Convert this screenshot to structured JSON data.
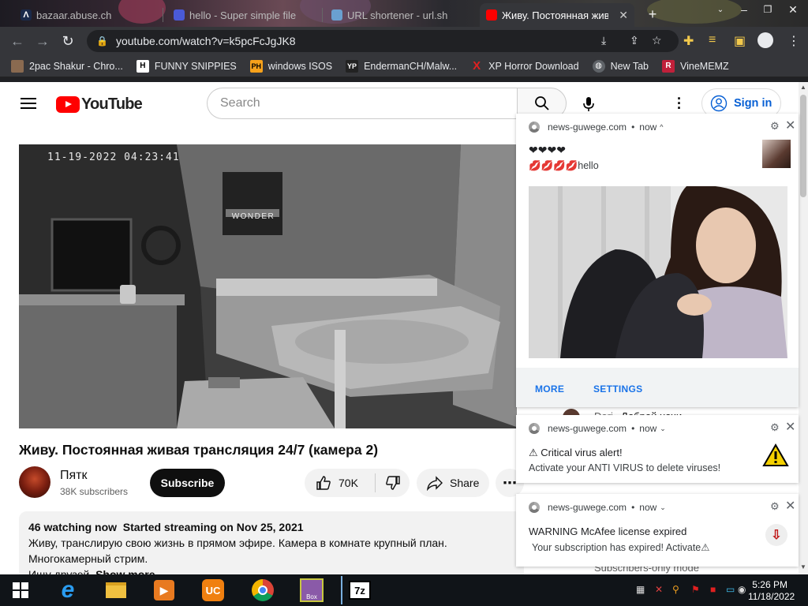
{
  "browser": {
    "tabs": [
      {
        "label": "bazaar.abuse.ch",
        "active": false
      },
      {
        "label": "hello - Super simple file",
        "active": false
      },
      {
        "label": "URL shortener - url.sh",
        "active": false
      },
      {
        "label": "Живу. Постоянная жива",
        "active": true
      }
    ],
    "url": "youtube.com/watch?v=k5pcFcJgJK8",
    "bookmarks": [
      {
        "label": "2pac Shakur - Chro...",
        "icon": "ph-icon"
      },
      {
        "label": "FUNNY SNIPPIES",
        "icon": "H"
      },
      {
        "label": "windows ISOS",
        "icon": "PH"
      },
      {
        "label": "EndermanCH/Malw...",
        "icon": "YP"
      },
      {
        "label": "XP Horror Download",
        "icon": "X"
      },
      {
        "label": "New Tab",
        "icon": "globe"
      },
      {
        "label": "VineMEMZ",
        "icon": "R"
      }
    ]
  },
  "youtube": {
    "logo_text": "YouTube",
    "search_placeholder": "Search",
    "signin_label": "Sign in",
    "video_timestamp": "11-19-2022  04:23:41",
    "poster_text": "WONDER",
    "title": "Живу. Постоянная живая трансляция 24/7 (камера 2)",
    "channel_name": "Пятк",
    "subscribers": "38K subscribers",
    "subscribe_label": "Subscribe",
    "likes": "70K",
    "share_label": "Share",
    "description": {
      "watching": "46 watching now",
      "started": "Started streaming on Nov 25, 2021",
      "line1": "Живу, транслирую свою жизнь в прямом эфире. Камера в комнате крупный план.",
      "line2": "Многокамерный стрим.",
      "line3": "Ищу друзей.",
      "show_more": "Show more"
    },
    "chat_peek": [
      {
        "author": "Dori",
        "text": "Доброй ночи"
      },
      {
        "author": "",
        "text": "Subscribers-only mode"
      }
    ]
  },
  "notifications": [
    {
      "source": "news-guwege.com",
      "time": "now",
      "title": "❤❤❤❤",
      "body": "💋💋💋💋hello",
      "buttons": [
        "MORE",
        "SETTINGS"
      ]
    },
    {
      "source": "news-guwege.com",
      "time": "now",
      "title": "⚠ Critical virus alert!",
      "body": "Activate your ANTI VIRUS to delete viruses!"
    },
    {
      "source": "news-guwege.com",
      "time": "now",
      "title": "WARNING McAfee license expired",
      "body": "Your subscription has expired! Activate⚠"
    }
  ],
  "taskbar": {
    "time": "5:26 PM",
    "date": "11/18/2022",
    "apps": [
      "start",
      "internet-explorer",
      "file-explorer",
      "media-player",
      "uc-browser",
      "chrome",
      "bonzi-buddy",
      "7zip"
    ]
  },
  "colors": {
    "yt_red": "#ff0000",
    "link_blue": "#065fd4",
    "notif_button": "#1a73e8",
    "chrome_dark": "#35363a"
  }
}
